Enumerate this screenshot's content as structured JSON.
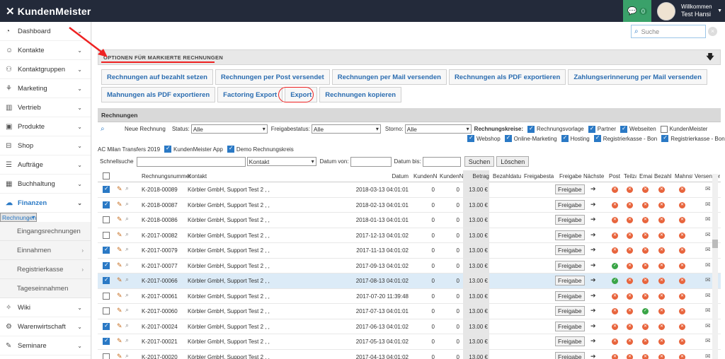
{
  "app": {
    "logo": "KundenMeister",
    "chat_count": "0",
    "welcome": "Willkommen",
    "user": "Test Hansi"
  },
  "search": {
    "placeholder": "Suche"
  },
  "sidebar": {
    "items": [
      {
        "label": "Dashboard",
        "icon": "dashboard-icon",
        "glyph": "◔"
      },
      {
        "label": "Kontakte",
        "icon": "contacts-icon",
        "glyph": "☺"
      },
      {
        "label": "Kontaktgruppen",
        "icon": "group-icon",
        "glyph": "⚇"
      },
      {
        "label": "Marketing",
        "icon": "marketing-icon",
        "glyph": "⚘"
      },
      {
        "label": "Vertrieb",
        "icon": "chart-icon",
        "glyph": "▥"
      },
      {
        "label": "Produkte",
        "icon": "box-icon",
        "glyph": "▣"
      },
      {
        "label": "Shop",
        "icon": "shop-icon",
        "glyph": "⊟"
      },
      {
        "label": "Aufträge",
        "icon": "orders-icon",
        "glyph": "☰"
      },
      {
        "label": "Buchhaltung",
        "icon": "accounting-icon",
        "glyph": "▦"
      },
      {
        "label": "Finanzen",
        "icon": "finance-icon",
        "glyph": "☁"
      }
    ],
    "subitems": [
      {
        "label": "Rechnungen",
        "chev": true
      },
      {
        "label": "Eingangsrechnungen",
        "chev": false
      },
      {
        "label": "Einnahmen",
        "chev": true
      },
      {
        "label": "Registrierkasse",
        "chev": true
      },
      {
        "label": "Tageseinnahmen",
        "chev": false
      }
    ],
    "items2": [
      {
        "label": "Wiki",
        "icon": "bulb-icon",
        "glyph": "✧"
      },
      {
        "label": "Warenwirtschaft",
        "icon": "warehouse-icon",
        "glyph": "⚙"
      },
      {
        "label": "Seminare",
        "icon": "seminar-icon",
        "glyph": "✎"
      }
    ]
  },
  "panel": {
    "title": "OPTIONEN FÜR MARKIERTE RECHNUNGEN",
    "buttons1": [
      "Rechnungen auf bezahlt setzen",
      "Rechnungen per Post versendet",
      "Rechnungen per Mail versenden",
      "Rechnungen als PDF exportieren",
      "Zahlungserinnerung per Mail versenden"
    ],
    "buttons2": [
      "Mahnungen als PDF exportieren",
      "Factoring Export",
      "Export",
      "Rechnungen kopieren"
    ]
  },
  "list": {
    "title": "Rechnungen"
  },
  "filters": {
    "new_invoice": "Neue Rechnung",
    "status_label": "Status:",
    "status_value": "Alle",
    "freigabe_label": "Freigabestatus:",
    "freigabe_value": "Alle",
    "storno_label": "Storno:",
    "storno_value": "Alle",
    "kreise_label": "Rechnungskreise:",
    "kreise_row1": [
      {
        "label": "Rechnungsvorlage",
        "on": true
      },
      {
        "label": "Partner",
        "on": true
      },
      {
        "label": "Webseiten",
        "on": true
      },
      {
        "label": "KundenMeister",
        "on": false
      }
    ],
    "kreise_row2": [
      {
        "label": "Webshop",
        "on": true
      },
      {
        "label": "Online-Marketing",
        "on": true
      },
      {
        "label": "Hosting",
        "on": true
      },
      {
        "label": "Registrierkasse - Bon",
        "on": true
      },
      {
        "label": "Registrierkasse - Bon",
        "on": true
      }
    ],
    "row3_prefix": "AC Milan Transfers 2019",
    "kreise_row3": [
      {
        "label": "KundenMeister App",
        "on": true
      },
      {
        "label": "Demo Rechnungskreis",
        "on": true
      }
    ],
    "quick_label": "Schnellsuche",
    "field_value": "Kontakt",
    "date_from": "Datum von:",
    "date_to": "Datum bis:",
    "search_btn": "Suchen",
    "clear_btn": "Löschen"
  },
  "table": {
    "headers": [
      "Rechnungsnummer",
      "Kontakt",
      "Datum",
      "KundenN",
      "KundenN",
      "Betrag",
      "Bezahldatu",
      "Freigabesta",
      "Freigabe",
      "Nächste",
      "Post",
      "Teilza",
      "Emai",
      "Bezahlt",
      "Mahnst",
      "Versenden"
    ],
    "freigabe_btn": "Freigabe",
    "rows": [
      {
        "num": "K-2018-00089",
        "contact": "Körbler GmbH, Support Test 2 , ,",
        "date": "2018-03-13 04:01:01",
        "k1": "0",
        "k2": "0",
        "amount": "13.00 €",
        "checked": true,
        "post": "x",
        "teil": "x",
        "mail": "x",
        "paid": "x",
        "dun": "x"
      },
      {
        "num": "K-2018-00087",
        "contact": "Körbler GmbH, Support Test 2 , ,",
        "date": "2018-02-13 04:01:01",
        "k1": "0",
        "k2": "0",
        "amount": "13.00 €",
        "checked": true,
        "post": "x",
        "teil": "x",
        "mail": "x",
        "paid": "x",
        "dun": "x"
      },
      {
        "num": "K-2018-00086",
        "contact": "Körbler GmbH, Support Test 2 , ,",
        "date": "2018-01-13 04:01:01",
        "k1": "0",
        "k2": "0",
        "amount": "13.00 €",
        "checked": false,
        "post": "x",
        "teil": "x",
        "mail": "x",
        "paid": "x",
        "dun": "x"
      },
      {
        "num": "K-2017-00082",
        "contact": "Körbler GmbH, Support Test 2 , ,",
        "date": "2017-12-13 04:01:02",
        "k1": "0",
        "k2": "0",
        "amount": "13.00 €",
        "checked": false,
        "post": "x",
        "teil": "x",
        "mail": "x",
        "paid": "x",
        "dun": "x"
      },
      {
        "num": "K-2017-00079",
        "contact": "Körbler GmbH, Support Test 2 , ,",
        "date": "2017-11-13 04:01:02",
        "k1": "0",
        "k2": "0",
        "amount": "13.00 €",
        "checked": true,
        "post": "x",
        "teil": "x",
        "mail": "x",
        "paid": "x",
        "dun": "x"
      },
      {
        "num": "K-2017-00077",
        "contact": "Körbler GmbH, Support Test 2 , ,",
        "date": "2017-09-13 04:01:02",
        "k1": "0",
        "k2": "0",
        "amount": "13.00 €",
        "checked": true,
        "post": "ok",
        "teil": "x",
        "mail": "x",
        "paid": "x",
        "dun": "x"
      },
      {
        "num": "K-2017-00066",
        "contact": "Körbler GmbH, Support Test 2 , ,",
        "date": "2017-08-13 04:01:02",
        "k1": "0",
        "k2": "0",
        "amount": "13.00 €",
        "checked": true,
        "hl": true,
        "post": "ok",
        "teil": "x",
        "mail": "x",
        "paid": "x",
        "dun": "x"
      },
      {
        "num": "K-2017-00061",
        "contact": "Körbler GmbH, Support Test 2 , ,",
        "date": "2017-07-20 11:39:48",
        "k1": "0",
        "k2": "0",
        "amount": "13.00 €",
        "checked": false,
        "post": "x",
        "teil": "x",
        "mail": "x",
        "paid": "x",
        "dun": "x"
      },
      {
        "num": "K-2017-00060",
        "contact": "Körbler GmbH, Support Test 2 , ,",
        "date": "2017-07-13 04:01:01",
        "k1": "0",
        "k2": "0",
        "amount": "13.00 €",
        "checked": false,
        "post": "x",
        "teil": "x",
        "mail": "ok",
        "paid": "x",
        "dun": "x"
      },
      {
        "num": "K-2017-00024",
        "contact": "Körbler GmbH, Support Test 2 , ,",
        "date": "2017-06-13 04:01:02",
        "k1": "0",
        "k2": "0",
        "amount": "13.00 €",
        "checked": true,
        "post": "x",
        "teil": "x",
        "mail": "x",
        "paid": "x",
        "dun": "x"
      },
      {
        "num": "K-2017-00021",
        "contact": "Körbler GmbH, Support Test 2 , ,",
        "date": "2017-05-13 04:01:02",
        "k1": "0",
        "k2": "0",
        "amount": "13.00 €",
        "checked": true,
        "post": "x",
        "teil": "x",
        "mail": "x",
        "paid": "x",
        "dun": "x"
      },
      {
        "num": "K-2017-00020",
        "contact": "Körbler GmbH, Support Test 2 , ,",
        "date": "2017-04-13 04:01:02",
        "k1": "0",
        "k2": "0",
        "amount": "13.00 €",
        "checked": false,
        "post": "x",
        "teil": "x",
        "mail": "x",
        "paid": "x",
        "dun": "x"
      }
    ]
  }
}
